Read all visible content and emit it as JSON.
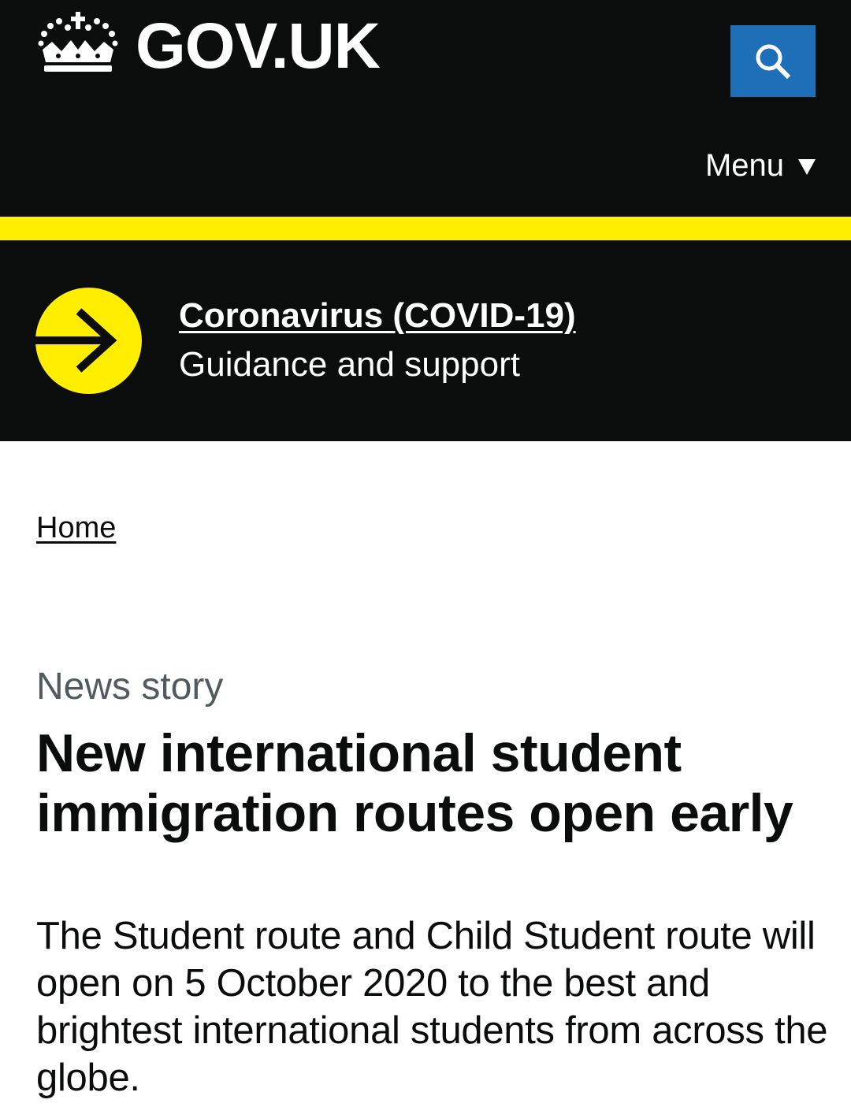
{
  "header": {
    "logo_text": "GOV.UK",
    "menu_label": "Menu",
    "search_icon": "search-icon",
    "crown_icon": "crown-icon",
    "colors": {
      "background": "#0b0c0c",
      "search_button": "#1d70b8",
      "stripe": "#ffee00"
    }
  },
  "covid_banner": {
    "icon": "arrow-right-icon",
    "link_text": "Coronavirus (COVID-19)",
    "subtitle": "Guidance and support",
    "accent": "#ffee00"
  },
  "breadcrumb": {
    "home": "Home"
  },
  "article": {
    "content_type": "News story",
    "title": "New international student immigration routes open early",
    "lead": "The Student route and Child Student route will open on 5 October 2020 to the best and brightest international students from across the globe."
  }
}
